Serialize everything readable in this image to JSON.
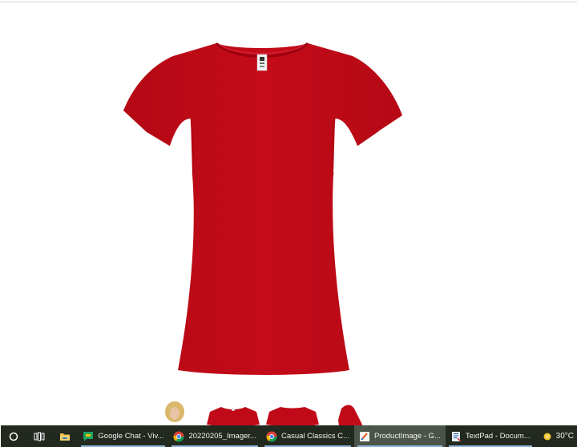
{
  "product": {
    "main_image_alt": "Red t-shirt",
    "shirt_color": "#c10a18",
    "shirt_shadow": "#a4000f",
    "tag_text": "Jhk"
  },
  "thumbnails": [
    {
      "icon": "model-photo-icon"
    },
    {
      "icon": "shirt-front-icon"
    },
    {
      "icon": "shirt-back-icon"
    },
    {
      "icon": "shirt-side-icon"
    }
  ],
  "taskbar": {
    "apps": [
      {
        "label": "Google Chat - Viv...",
        "icon": "google-chat-icon",
        "active": false
      },
      {
        "label": "20220205_Imager...",
        "icon": "chrome-icon",
        "active": false
      },
      {
        "label": "Casual Classics C...",
        "icon": "chrome-icon",
        "active": false
      },
      {
        "label": "ProductImage - G...",
        "icon": "paint-icon",
        "active": true
      },
      {
        "label": "TextPad - Docum...",
        "icon": "textpad-icon",
        "active": false
      }
    ],
    "weather": {
      "temp": "30°C",
      "icon": "sun-icon"
    }
  }
}
